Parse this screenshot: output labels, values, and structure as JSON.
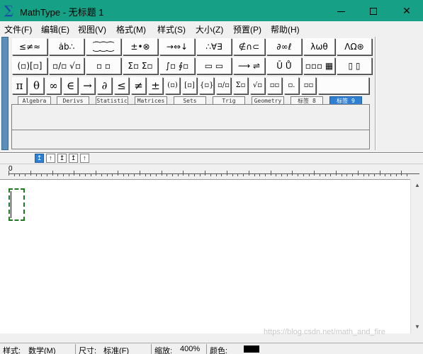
{
  "window": {
    "title": "MathType - 无标题 1",
    "app_icon": "∑",
    "minimize_icon": "minimize-icon",
    "maximize_icon": "maximize-icon",
    "close_icon": "close-icon",
    "close_glyph": "✕",
    "titlebar_color": "#16a085"
  },
  "menu": {
    "items": [
      "文件(F)",
      "编辑(E)",
      "视图(V)",
      "格式(M)",
      "样式(S)",
      "大小(Z)",
      "预置(P)",
      "帮助(H)"
    ]
  },
  "palette": {
    "row1": [
      "≤≠≈",
      "ȧb∴",
      "⁐⁐⁐",
      "±•⊗",
      "→⇔↓",
      "∴∀∃",
      "∉∩⊂",
      "∂∞ℓ",
      "λωθ",
      "ΛΩ⊛"
    ],
    "row2": [
      "(▫)[▫]",
      "▫/▫ √▫",
      "▫ ▫",
      "Σ▫ Σ▫",
      "∫▫ ∮▫",
      "▭ ▭",
      "⟶ ⇌",
      "Ū Ů",
      "▫▫▫ ▦",
      "▯ ▯"
    ],
    "symbols": [
      "π",
      "θ",
      "∞",
      "∈",
      "→",
      "∂",
      "≤",
      "≠",
      "±",
      "(▫)",
      "[▫]",
      "{▫}",
      "▫/▫",
      "Σ▫",
      "√▫",
      "▫▫",
      "▫.",
      "▫▫"
    ],
    "tabs": [
      "Algebra",
      "Derivs",
      "Statistic",
      "Matrices",
      "Sets",
      "Trig",
      "Geometry",
      "标签 8",
      "标签 9"
    ],
    "active_tab": "标签 9"
  },
  "small_toolbar": {
    "buttons": [
      "↥",
      "↑",
      "↥",
      "↥",
      "↑"
    ]
  },
  "ruler": {
    "zero": "0"
  },
  "statusbar": {
    "style_label": "样式:",
    "style_value": "数学(M)",
    "size_label": "尺寸:",
    "size_value": "标准(F)",
    "zoom_label": "缩放:",
    "zoom_value": "400%",
    "color_label": "颜色:",
    "color_value": "#000000"
  },
  "watermark": "https://blog.csdn.net/math_and_fire"
}
